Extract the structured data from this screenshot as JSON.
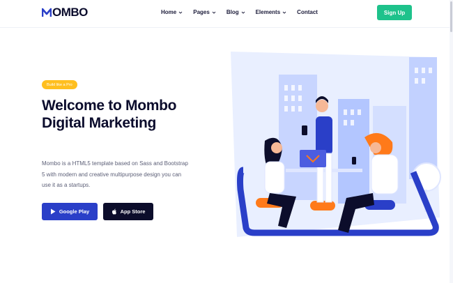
{
  "header": {
    "logo_text": "OMBO",
    "logo_icon": "m-logo-icon",
    "nav": [
      {
        "label": "Home",
        "has_dropdown": true
      },
      {
        "label": "Pages",
        "has_dropdown": true
      },
      {
        "label": "Blog",
        "has_dropdown": true
      },
      {
        "label": "Elements",
        "has_dropdown": true
      },
      {
        "label": "Contact",
        "has_dropdown": false
      }
    ],
    "signup_label": "Sign Up"
  },
  "hero": {
    "badge": "Build like a Pro",
    "title": "Welcome to Mombo Digital Marketing",
    "description": "Mombo is a HTML5 template based on Sass and Bootstrap 5 with modern and creative multipurpose design you can use it as a startups.",
    "buttons": [
      {
        "label": "Google Play",
        "icon": "google-play-icon"
      },
      {
        "label": "App Store",
        "icon": "apple-icon"
      }
    ]
  },
  "colors": {
    "primary_blue": "#2a3fc8",
    "dark_navy": "#0c0d2b",
    "green_signup": "#1ec28b",
    "badge_yellow": "#ffbf1f",
    "illustration_orange": "#ff7a1a"
  }
}
